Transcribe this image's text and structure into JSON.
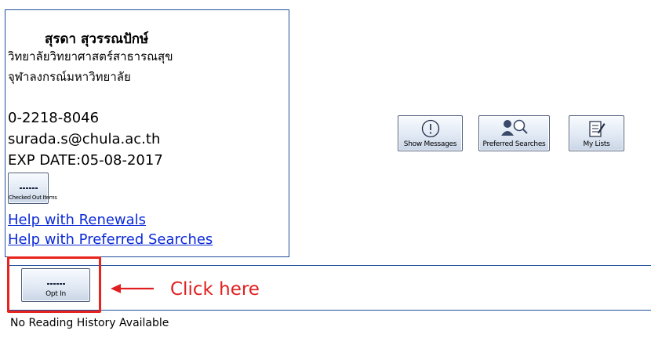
{
  "patron": {
    "name": "สุรดา สุวรรณปักษ์",
    "department": "วิทยาลัยวิทยาศาสตร์สาธารณสุข",
    "university": "จุฬาลงกรณ์มหาวิทยาลัย",
    "phone": "0-2218-8046",
    "email": "surada.s@chula.ac.th",
    "expiry": "EXP DATE:05-08-2017"
  },
  "buttons": {
    "checked_out": {
      "label": "Checked Out Items",
      "icon": "books-icon"
    },
    "show_messages": {
      "label": "Show Messages",
      "icon": "info-icon"
    },
    "preferred_searches": {
      "label": "Preferred Searches",
      "icon": "people-search-icon"
    },
    "my_lists": {
      "label": "My Lists",
      "icon": "list-edit-icon"
    },
    "opt_in": {
      "label": "Opt In",
      "icon": "books-icon"
    }
  },
  "links": {
    "help_renewals": "Help with Renewals",
    "help_preferred_searches": "Help with Preferred Searches"
  },
  "annotation": {
    "text": "Click here",
    "color": "#e02020"
  },
  "reading_history": {
    "status": "No Reading History Available"
  },
  "colors": {
    "box_border": "#1f4e9c",
    "link": "#0b2ad8",
    "highlight": "#e8221c"
  }
}
